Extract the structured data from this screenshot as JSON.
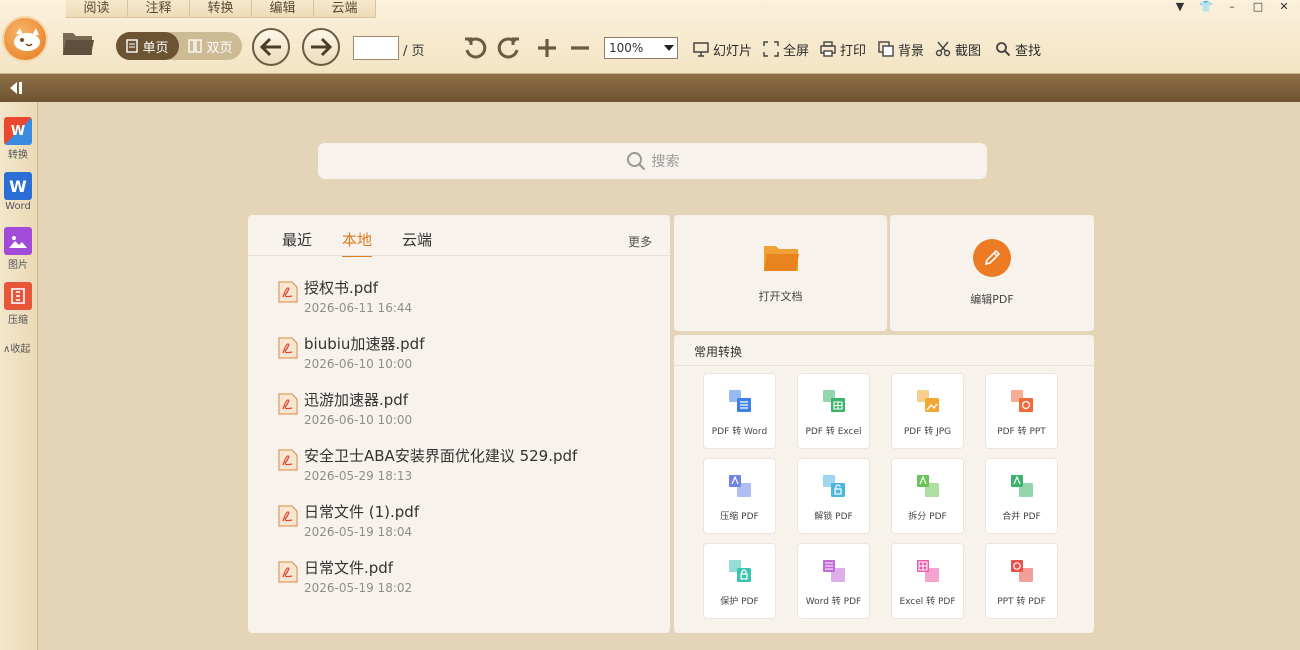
{
  "menu_tabs": [
    "阅读",
    "注释",
    "转换",
    "编辑",
    "云端"
  ],
  "toolbar": {
    "single_page": "单页",
    "double_page": "双页",
    "page_unit": "/ 页",
    "page_value": "",
    "zoom": "100%",
    "buttons": [
      "幻灯片",
      "全屏",
      "打印",
      "背景",
      "截图",
      "查找"
    ]
  },
  "sidebar": {
    "items": [
      {
        "label": "转换",
        "icon": "pdf-convert-icon",
        "color": "#e8492f"
      },
      {
        "label": "Word",
        "icon": "word-icon",
        "color": "#2b6fd6"
      },
      {
        "label": "图片",
        "icon": "image-icon",
        "color": "#a24bd8"
      },
      {
        "label": "压缩",
        "icon": "compress-icon",
        "color": "#e8563a"
      }
    ],
    "collapse": "收起"
  },
  "search": {
    "placeholder": "搜索"
  },
  "recent_panel": {
    "tabs": [
      "最近",
      "本地",
      "云端"
    ],
    "active_tab": "本地",
    "more": "更多",
    "files": [
      {
        "name": "授权书.pdf",
        "date": "2026-06-11 16:44"
      },
      {
        "name": "biubiu加速器.pdf",
        "date": "2026-06-10 10:00"
      },
      {
        "name": "迅游加速器.pdf",
        "date": "2026-06-10 10:00"
      },
      {
        "name": "安全卫士ABA安装界面优化建议 529.pdf",
        "date": "2026-05-29 18:13"
      },
      {
        "name": "日常文件 (1).pdf",
        "date": "2026-05-19 18:04"
      },
      {
        "name": "日常文件.pdf",
        "date": "2026-05-19 18:02"
      }
    ]
  },
  "actions": {
    "open": "打开文档",
    "edit": "编辑PDF"
  },
  "conversions": {
    "title": "常用转换",
    "tiles": [
      {
        "label": "PDF 转 Word",
        "color": "#3f82e6"
      },
      {
        "label": "PDF 转 Excel",
        "color": "#3cb36b"
      },
      {
        "label": "PDF 转 JPG",
        "color": "#f0a935"
      },
      {
        "label": "PDF 转 PPT",
        "color": "#f06a3a"
      },
      {
        "label": "压缩 PDF",
        "color": "#6f86e8"
      },
      {
        "label": "解锁 PDF",
        "color": "#4db5e0"
      },
      {
        "label": "拆分 PDF",
        "color": "#6cc25a"
      },
      {
        "label": "合并 PDF",
        "color": "#3cb36b"
      },
      {
        "label": "保护 PDF",
        "color": "#3cc2b0"
      },
      {
        "label": "Word 转 PDF",
        "color": "#c26ad8"
      },
      {
        "label": "Excel 转 PDF",
        "color": "#e85aa8"
      },
      {
        "label": "PPT 转 PDF",
        "color": "#e8504a"
      }
    ]
  }
}
